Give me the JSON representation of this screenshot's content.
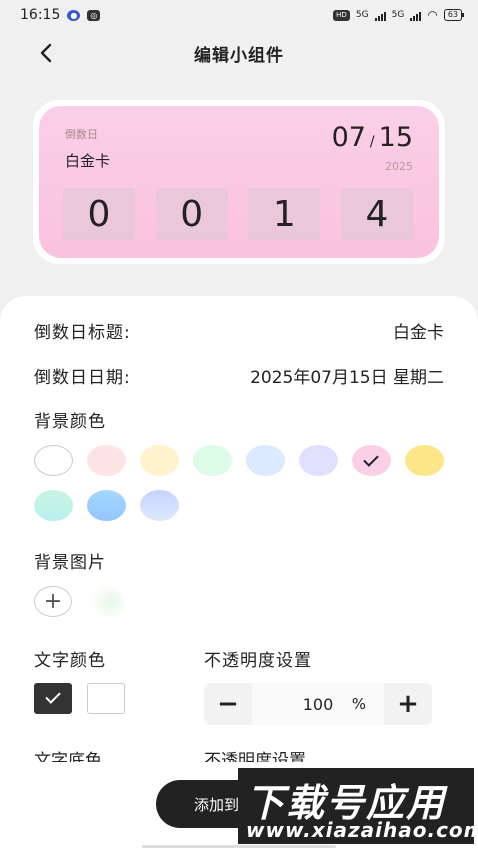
{
  "status_bar": {
    "time": "16:15",
    "network": "5G",
    "network2": "5G",
    "hd": "HD",
    "battery": "63"
  },
  "nav": {
    "title": "编辑小组件"
  },
  "widget": {
    "small_label": "倒数日",
    "name": "白金卡",
    "month": "07",
    "sep": "/",
    "day": "15",
    "year": "2025",
    "digits": [
      "0",
      "0",
      "1",
      "4"
    ],
    "background": "#fbcfe8"
  },
  "form": {
    "title_label": "倒数日标题:",
    "title_value": "白金卡",
    "date_label": "倒数日日期:",
    "date_value": "2025年07月15日 星期二",
    "bg_color_label": "背景颜色",
    "bg_colors": [
      {
        "color": "#ffffff",
        "selected": false
      },
      {
        "color": "#ffe4e6",
        "selected": false
      },
      {
        "color": "#fff3cd",
        "selected": false
      },
      {
        "color": "#dcfce7",
        "selected": false
      },
      {
        "color": "#dbeafe",
        "selected": false
      },
      {
        "color": "#e0e0ff",
        "selected": false
      },
      {
        "color": "#fbcfe8",
        "selected": true
      },
      {
        "color": "#fde68a",
        "selected": false
      },
      {
        "color": "linear-gradient(180deg,#c8f5e0,#b8f0f0)",
        "selected": false
      },
      {
        "color": "linear-gradient(180deg,#a5d8ff,#93c5fd)",
        "selected": false
      },
      {
        "color": "linear-gradient(180deg,#c7d2fe,#dbeafe)",
        "selected": false
      }
    ],
    "bg_image_label": "背景图片",
    "add_image_symbol": "+",
    "text_color_label": "文字颜色",
    "opacity_label": "不透明度设置",
    "opacity_value": "100",
    "opacity_unit": "%",
    "minus_symbol": "−",
    "plus_symbol": "+",
    "text_bg_label_partial": "文字底色",
    "opacity_label_2": "不透明度设置"
  },
  "actions": {
    "add_button_label": "添加到"
  },
  "watermark": {
    "top": "下载号应用",
    "bottom": "www.xiazaihao.com"
  }
}
